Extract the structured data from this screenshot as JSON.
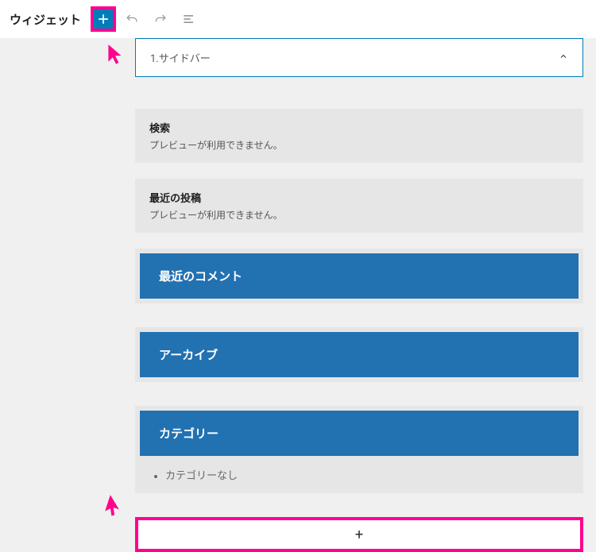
{
  "topbar": {
    "title": "ウィジェット"
  },
  "panel": {
    "label": "1.サイドバー"
  },
  "widgets": {
    "search": {
      "title": "検索",
      "desc": "プレビューが利用できません。"
    },
    "recent_posts": {
      "title": "最近の投稿",
      "desc": "プレビューが利用できません。"
    },
    "recent_comments": {
      "title": "最近のコメント"
    },
    "archives": {
      "title": "アーカイブ"
    },
    "categories": {
      "title": "カテゴリー",
      "item": "カテゴリーなし"
    }
  },
  "add_block": {
    "plus": "+"
  },
  "colors": {
    "highlight": "#ff008f",
    "primary": "#2271b1"
  }
}
